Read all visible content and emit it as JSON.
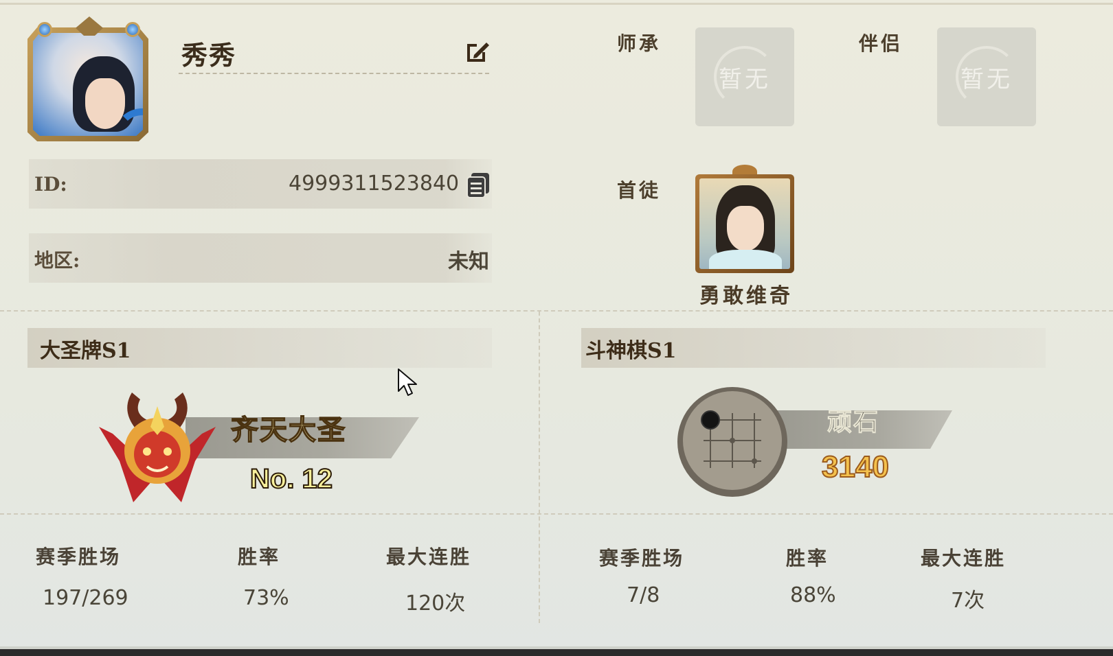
{
  "profile": {
    "name": "秀秀",
    "id_label": "ID:",
    "id_value": "4999311523840",
    "region_label": "地区:",
    "region_value": "未知"
  },
  "relations": {
    "master_label": "师承",
    "master_value": "暂无",
    "partner_label": "伴侣",
    "partner_value": "暂无",
    "disciple_label": "首徒",
    "disciple_name": "勇敢维奇"
  },
  "dasheng": {
    "title": "大圣牌S1",
    "rank_name": "齐天大圣",
    "rank_no": "No. 12",
    "stats": [
      {
        "label": "赛季胜场",
        "value": "197/269"
      },
      {
        "label": "胜率",
        "value": "73%"
      },
      {
        "label": "最大连胜",
        "value": "120次"
      }
    ]
  },
  "doushen": {
    "title": "斗神棋S1",
    "rank_name": "顽石",
    "score": "3140",
    "stats": [
      {
        "label": "赛季胜场",
        "value": "7/8"
      },
      {
        "label": "胜率",
        "value": "88%"
      },
      {
        "label": "最大连胜",
        "value": "7次"
      }
    ]
  },
  "icons": {
    "edit": "edit-icon",
    "copy": "copy-icon",
    "cursor": "mouse-cursor-icon"
  }
}
